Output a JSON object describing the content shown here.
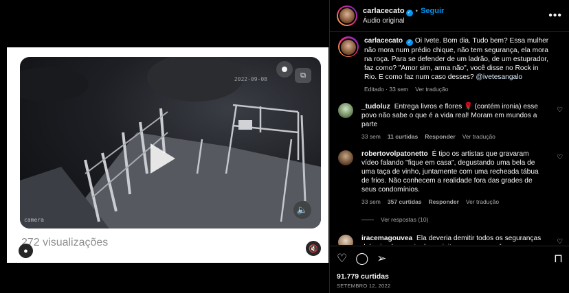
{
  "media": {
    "cam_date": "2022-09-08",
    "cam_label": "camera",
    "views": "272 visualizações",
    "icons": {
      "play": "play-icon",
      "pip": "pip-icon",
      "sound": "speaker-icon",
      "tagged": "user-icon",
      "mute": "muted-speaker-icon"
    }
  },
  "header": {
    "username": "carlacecato",
    "follow": "Seguir",
    "separator": "•",
    "audio": "Áudio original",
    "more": "•••"
  },
  "caption": {
    "username": "carlacecato",
    "text": "Oi Ivete. Bom dia. Tudo bem? Essa mulher não mora num prédio chique, não tem segurança, ela mora na roça. Para se defender de um ladrão, de um estuprador, faz como? \"Amor sim, arma não\", você disse no Rock in Rio. E como faz num caso desses?",
    "mention": "@ivetesangalo",
    "edited": "Editado · 33 sem",
    "translate": "Ver tradução"
  },
  "comments": [
    {
      "username": "_tudoluz",
      "text": "Entrega livros e flores 🌹 (contém ironia) esse povo não sabe o que é a vida real! Moram em mundos a parte",
      "time": "33 sem",
      "likes": "11 curtidas",
      "reply": "Responder",
      "translate": "Ver tradução"
    },
    {
      "username": "robertovolpatonetto",
      "text": "É tipo os artistas que gravaram vídeo falando \"fique em casa\", degustando uma bela de uma taça de vinho, juntamente com uma recheada tábua de frios. Não conhecem a realidade fora das grades de seus condomínios.",
      "time": "33 sem",
      "likes": "357 curtidas",
      "reply": "Responder",
      "translate": "Ver tradução",
      "view_replies": "Ver respostas (10)"
    },
    {
      "username": "iracemagouvea",
      "text": "Ela deveria demitir todos os seguranças dela simplesmente desse jeito, uma pessoa famosa que têm dinheiro e vive numa bolha e cheias de mordomias e claro as"
    }
  ],
  "actions": {
    "likes": "91.779 curtidas",
    "date": "SETEMBRO 12, 2022",
    "icons": {
      "like": "heart-icon",
      "comment": "comment-icon",
      "share": "send-icon",
      "save": "bookmark-icon"
    }
  },
  "colors": {
    "accent": "#0095f6",
    "background": "#000000",
    "muted_text": "#a8a8a8"
  }
}
